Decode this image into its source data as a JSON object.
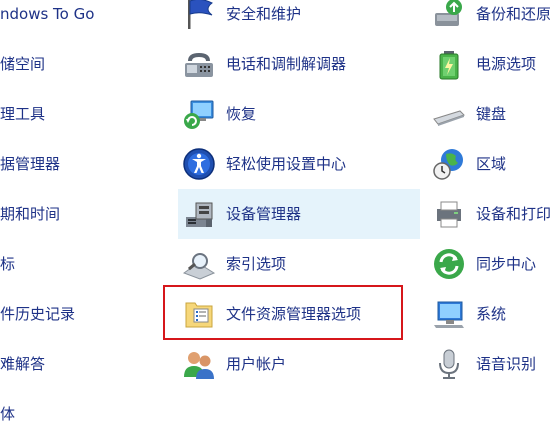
{
  "colors": {
    "link_text": "#1e3287",
    "hover_bg": "#e5f3fb",
    "highlight_border": "#d6171b"
  },
  "column_left": {
    "items": [
      {
        "label": "ndows To Go"
      },
      {
        "label": "储空间"
      },
      {
        "label": "理工具"
      },
      {
        "label": "据管理器"
      },
      {
        "label": "期和时间"
      },
      {
        "label": "标"
      },
      {
        "label": "件历史记录"
      },
      {
        "label": "难解答"
      },
      {
        "label": "体"
      }
    ]
  },
  "column_middle": {
    "items": [
      {
        "label": "安全和维护",
        "icon": "flag-icon"
      },
      {
        "label": "电话和调制解调器",
        "icon": "phone-modem-icon"
      },
      {
        "label": "恢复",
        "icon": "recovery-icon"
      },
      {
        "label": "轻松使用设置中心",
        "icon": "ease-of-access-icon"
      },
      {
        "label": "设备管理器",
        "icon": "device-manager-icon",
        "hovered": true
      },
      {
        "label": "索引选项",
        "icon": "indexing-icon"
      },
      {
        "label": "文件资源管理器选项",
        "icon": "folder-options-icon",
        "highlighted": true
      },
      {
        "label": "用户帐户",
        "icon": "users-icon"
      }
    ]
  },
  "column_right": {
    "items": [
      {
        "label": "备份和还原",
        "icon": "backup-icon"
      },
      {
        "label": "电源选项",
        "icon": "battery-icon"
      },
      {
        "label": "键盘",
        "icon": "keyboard-icon"
      },
      {
        "label": "区域",
        "icon": "globe-clock-icon"
      },
      {
        "label": "设备和打印",
        "icon": "printer-icon"
      },
      {
        "label": "同步中心",
        "icon": "sync-icon"
      },
      {
        "label": "系统",
        "icon": "computer-icon"
      },
      {
        "label": "语音识别",
        "icon": "microphone-icon"
      }
    ]
  }
}
